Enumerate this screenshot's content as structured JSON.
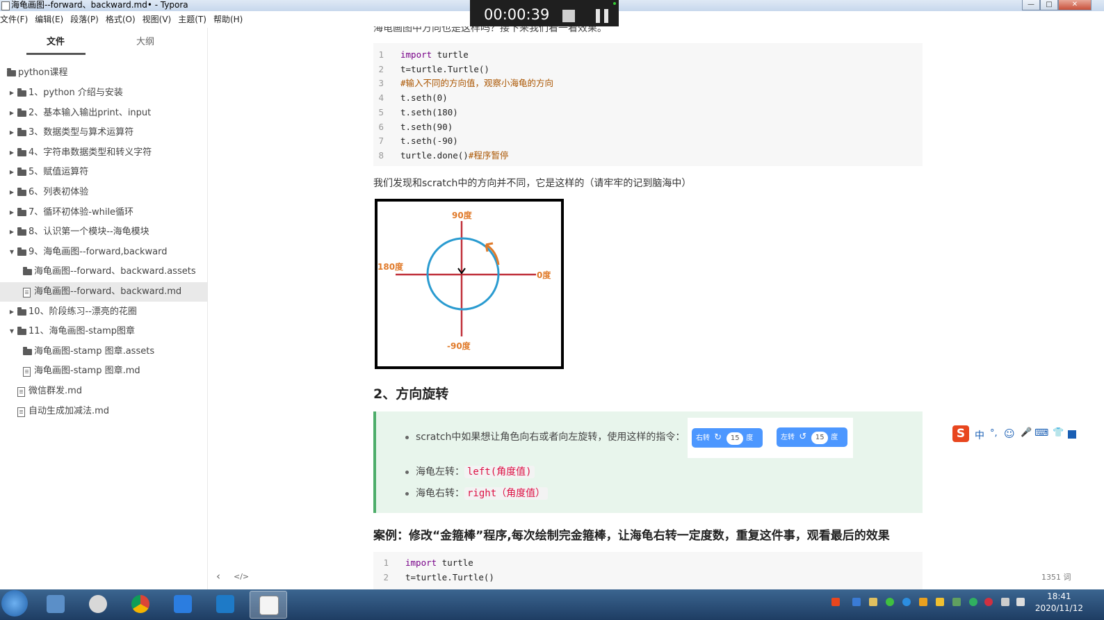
{
  "window": {
    "title": "海龟画图--forward、backward.md• - Typora",
    "controls": [
      "—",
      "□",
      "✕"
    ]
  },
  "menu": [
    "文件(F)",
    "编辑(E)",
    "段落(P)",
    "格式(O)",
    "视图(V)",
    "主题(T)",
    "帮助(H)"
  ],
  "recorder": {
    "time": "00:00:39"
  },
  "sidebar": {
    "tabs": [
      "文件",
      "大纲"
    ],
    "root": "python课程",
    "items": [
      {
        "label": "1、python 介绍与安装",
        "type": "folder",
        "expanded": false
      },
      {
        "label": "2、基本输入输出print、input",
        "type": "folder",
        "expanded": false
      },
      {
        "label": "3、数据类型与算术运算符",
        "type": "folder",
        "expanded": false
      },
      {
        "label": "4、字符串数据类型和转义字符",
        "type": "folder",
        "expanded": false
      },
      {
        "label": "5、赋值运算符",
        "type": "folder",
        "expanded": false
      },
      {
        "label": "6、列表初体验",
        "type": "folder",
        "expanded": false
      },
      {
        "label": "7、循环初体验-while循环",
        "type": "folder",
        "expanded": false
      },
      {
        "label": "8、认识第一个模块--海龟模块",
        "type": "folder",
        "expanded": false
      },
      {
        "label": "9、海龟画图--forward,backward",
        "type": "folder",
        "expanded": true
      },
      {
        "label": "海龟画图--forward、backward.assets",
        "type": "subfolder"
      },
      {
        "label": "海龟画图--forward、backward.md",
        "type": "file",
        "active": true
      },
      {
        "label": "10、阶段练习--漂亮的花圈",
        "type": "folder",
        "expanded": false
      },
      {
        "label": "11、海龟画图-stamp图章",
        "type": "folder",
        "expanded": true
      },
      {
        "label": "海龟画图-stamp 图章.assets",
        "type": "subfolder"
      },
      {
        "label": "海龟画图-stamp 图章.md",
        "type": "file"
      },
      {
        "label": "微信群发.md",
        "type": "rootfile"
      },
      {
        "label": "自动生成加减法.md",
        "type": "rootfile"
      }
    ],
    "add_button": "+"
  },
  "editor": {
    "top_partial_text": "海龟画图中方向也是这样吗？接下来我们看一看效果。",
    "code1": [
      {
        "n": "1",
        "parts": [
          [
            "kw",
            "import"
          ],
          [
            "txt",
            " turtle"
          ]
        ]
      },
      {
        "n": "2",
        "parts": [
          [
            "txt",
            "t=turtle.Turtle()"
          ]
        ]
      },
      {
        "n": "3",
        "parts": [
          [
            "cm",
            "#输入不同的方向值，观察小海龟的方向"
          ]
        ]
      },
      {
        "n": "4",
        "parts": [
          [
            "txt",
            "t.seth(0)"
          ]
        ]
      },
      {
        "n": "5",
        "parts": [
          [
            "txt",
            "t.seth(180)"
          ]
        ]
      },
      {
        "n": "6",
        "parts": [
          [
            "txt",
            "t.seth(90)"
          ]
        ]
      },
      {
        "n": "7",
        "parts": [
          [
            "txt",
            "t.seth(-90)"
          ]
        ]
      },
      {
        "n": "8",
        "parts": [
          [
            "txt",
            "turtle.done()"
          ],
          [
            "cm",
            "#程序暂停"
          ]
        ]
      }
    ],
    "para1": "我们发现和scratch中的方向并不同，它是这样的（请牢牢的记到脑海中）",
    "diagram_labels": {
      "up": "90度",
      "left": "180度",
      "right": "0度",
      "down": "-90度"
    },
    "heading2": "2、方向旋转",
    "bullets": {
      "b1": "scratch中如果想让角色向右或者向左旋转，使用这样的指令：",
      "b2_label": "海龟左转：",
      "b2_code": "left(角度值)",
      "b3_label": "海龟右转：",
      "b3_code": "right（角度值）"
    },
    "blocks": [
      {
        "label": "右转",
        "icon": "↻",
        "value": "15",
        "unit": "度"
      },
      {
        "label": "左转",
        "icon": "↺",
        "value": "15",
        "unit": "度"
      }
    ],
    "case_heading": "案例：修改“金箍棒”程序,每次绘制完金箍棒，让海龟右转一定度数，重复这件事，观看最后的效果",
    "code2": [
      {
        "n": "1",
        "parts": [
          [
            "kw",
            "import"
          ],
          [
            "txt",
            " turtle"
          ]
        ]
      },
      {
        "n": "2",
        "parts": [
          [
            "txt",
            "t=turtle.Turtle()"
          ]
        ]
      }
    ]
  },
  "footer": {
    "back": "‹",
    "source": "</>",
    "wordcount": "1351 词"
  },
  "ime": {
    "logo": "S",
    "lang": "中",
    "symbols": "°,",
    "items": [
      "☺",
      "🎤",
      "⌨",
      "👕"
    ]
  },
  "taskbar": {
    "time": "18:41",
    "date": "2020/11/12"
  },
  "colors": {
    "accent": "#4c97ff",
    "diagram_axis": "#c0303a",
    "diagram_circle": "#2a9bd0",
    "diagram_label": "#e07a2a"
  }
}
